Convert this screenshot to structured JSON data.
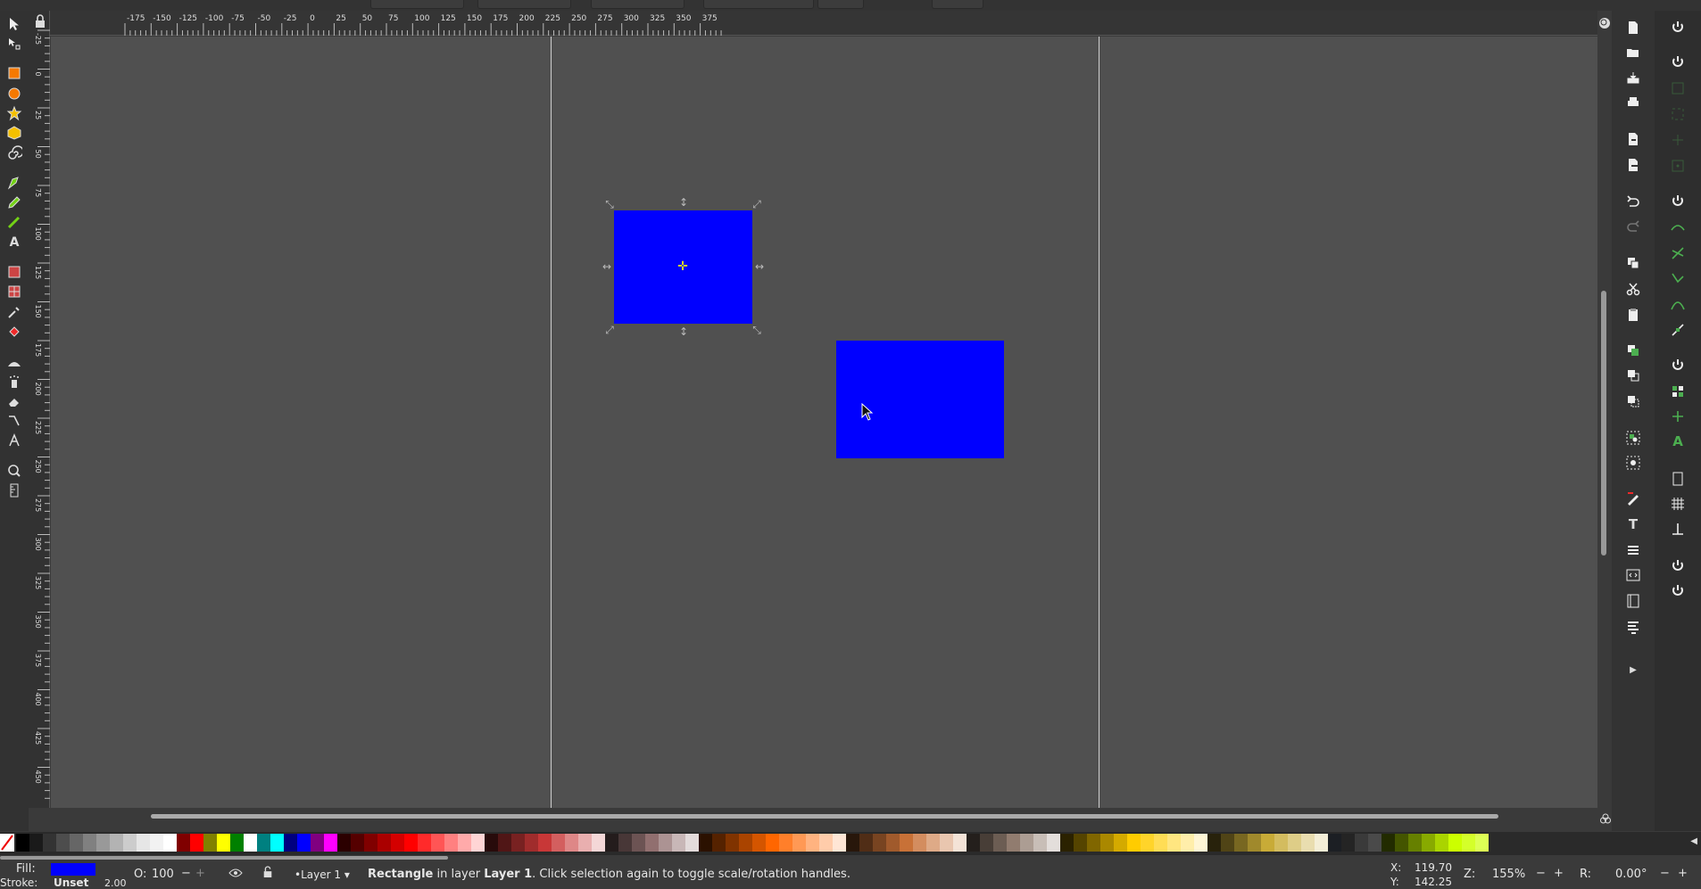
{
  "ruler": {
    "h_labels": [
      "-175",
      "-150",
      "-125",
      "-100",
      "-75",
      "-50",
      "-25",
      "0",
      "25",
      "50",
      "75",
      "100",
      "125",
      "150",
      "175",
      "200",
      "225",
      "250",
      "275",
      "300",
      "325",
      "350",
      "375"
    ],
    "v_labels": [
      "-25",
      "0",
      "25",
      "50",
      "75",
      "100",
      "125",
      "150",
      "175",
      "200",
      "225",
      "250",
      "275",
      "300",
      "325",
      "350",
      "375",
      "400",
      "425",
      "450"
    ]
  },
  "tools": [
    "selector-icon",
    "node-icon",
    "rectangle-icon",
    "ellipse-icon",
    "star-icon",
    "box3d-icon",
    "spiral-icon",
    "pen-icon",
    "pencil-icon",
    "calligraphy-icon",
    "text-icon",
    "gradient-icon",
    "mesh-icon",
    "dropper-icon",
    "paint-bucket-icon",
    "tweak-icon",
    "spray-icon",
    "eraser-icon",
    "connector-icon",
    "lpe-icon",
    "zoom-icon",
    "measure-icon"
  ],
  "commands": [
    "new-document-icon",
    "open-icon",
    "save-icon",
    "print-icon",
    "import-icon",
    "export-icon",
    "undo-icon",
    "redo-icon",
    "copy-icon",
    "cut-icon",
    "paste-icon",
    "duplicate-icon",
    "clone-icon",
    "unlink-clone-icon",
    "group-icon",
    "ungroup-icon",
    "fill-stroke-icon",
    "text-font-icon",
    "layers-icon",
    "xml-editor-icon",
    "objects-icon",
    "align-icon"
  ],
  "palette_colors": [
    "#000000",
    "#1a1a1a",
    "#333333",
    "#4d4d4d",
    "#666666",
    "#808080",
    "#999999",
    "#b3b3b3",
    "#cccccc",
    "#e6e6e6",
    "#f2f2f2",
    "#ffffff",
    "#800000",
    "#ff0000",
    "#808000",
    "#ffff00",
    "#008000",
    "#ffffff",
    "#008080",
    "#00ffff",
    "#000080",
    "#0000ff",
    "#800080",
    "#ff00ff",
    "#2b0000",
    "#550000",
    "#800000",
    "#aa0000",
    "#d40000",
    "#ff0000",
    "#ff2a2a",
    "#ff5555",
    "#ff8080",
    "#ffaaaa",
    "#ffd5d5",
    "#280b0b",
    "#501616",
    "#782121",
    "#a02c2c",
    "#c83737",
    "#d35f5f",
    "#de8787",
    "#e9afaf",
    "#f4d7d7",
    "#241c1c",
    "#483737",
    "#6c5353",
    "#916f6f",
    "#ac9393",
    "#c8b7b7",
    "#e3dbdb",
    "#2b1100",
    "#552200",
    "#803300",
    "#aa4400",
    "#d45500",
    "#ff6600",
    "#ff7f2a",
    "#ff9955",
    "#ffb380",
    "#ffccaa",
    "#ffe6d5",
    "#28170b",
    "#502d16",
    "#784421",
    "#a05a2c",
    "#c87137",
    "#d38d5f",
    "#deaa87",
    "#e9c6af",
    "#f4e3d7",
    "#241f1c",
    "#483e37",
    "#6c5d53",
    "#917c6f",
    "#ac9d93",
    "#c8beb7",
    "#e3dedb",
    "#2b2200",
    "#554400",
    "#806600",
    "#aa8800",
    "#d4aa00",
    "#ffcc00",
    "#ffd42a",
    "#ffdd55",
    "#ffe680",
    "#ffeeaa",
    "#fff6d5",
    "#28220b",
    "#504416",
    "#786721",
    "#a0892c",
    "#c8ab37",
    "#d3bc5f",
    "#decd87",
    "#e9ddaf",
    "#f4eed7",
    "#1c1f24",
    "#242424",
    "#3a3a3a",
    "#4a4a4a",
    "#222b00",
    "#445500",
    "#668000",
    "#88aa00",
    "#aad400",
    "#ccff00",
    "#d4ff2a",
    "#ddff55"
  ],
  "status": {
    "fill_label": "Fill:",
    "stroke_label": "Stroke:",
    "stroke_value": "Unset",
    "stroke_width": "2.00",
    "opacity_label": "O:",
    "opacity_value": "100",
    "layer_name": "•Layer 1",
    "message_bold": "Rectangle",
    "message_mid": " in layer ",
    "message_layer": "Layer 1",
    "message_tail": ". Click selection again to toggle scale/rotation handles.",
    "x_label": "X:",
    "x_value": "119.70",
    "y_label": "Y:",
    "y_value": "142.25",
    "zoom_label": "Z:",
    "zoom_value": "155%",
    "rotation_label": "R:",
    "rotation_value": "0.00°",
    "fill_color": "#0000ff"
  },
  "canvas": {
    "background": "#505050",
    "object_color": "#0000ff"
  }
}
